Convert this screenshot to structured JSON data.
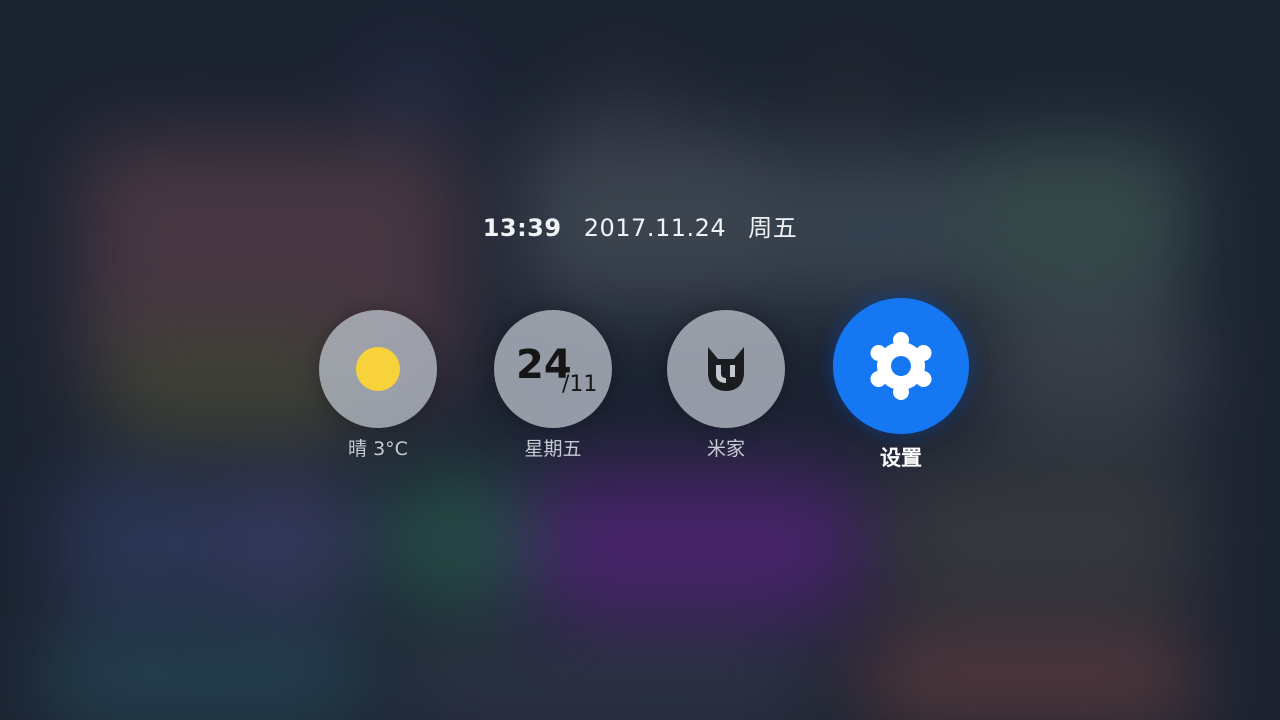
{
  "header": {
    "time": "13:39",
    "date": "2017.11.24",
    "weekday": "周五"
  },
  "tiles": [
    {
      "label": "晴 3°C",
      "icon": "sun-icon"
    },
    {
      "label": "星期五",
      "icon": "calendar-date-icon",
      "day": "24",
      "month": "/11"
    },
    {
      "label": "米家",
      "icon": "mijia-logo-icon"
    },
    {
      "label": "设置",
      "icon": "gear-icon"
    }
  ],
  "colors": {
    "sun": "#f7d23a",
    "settings_accent": "#1677f2"
  }
}
